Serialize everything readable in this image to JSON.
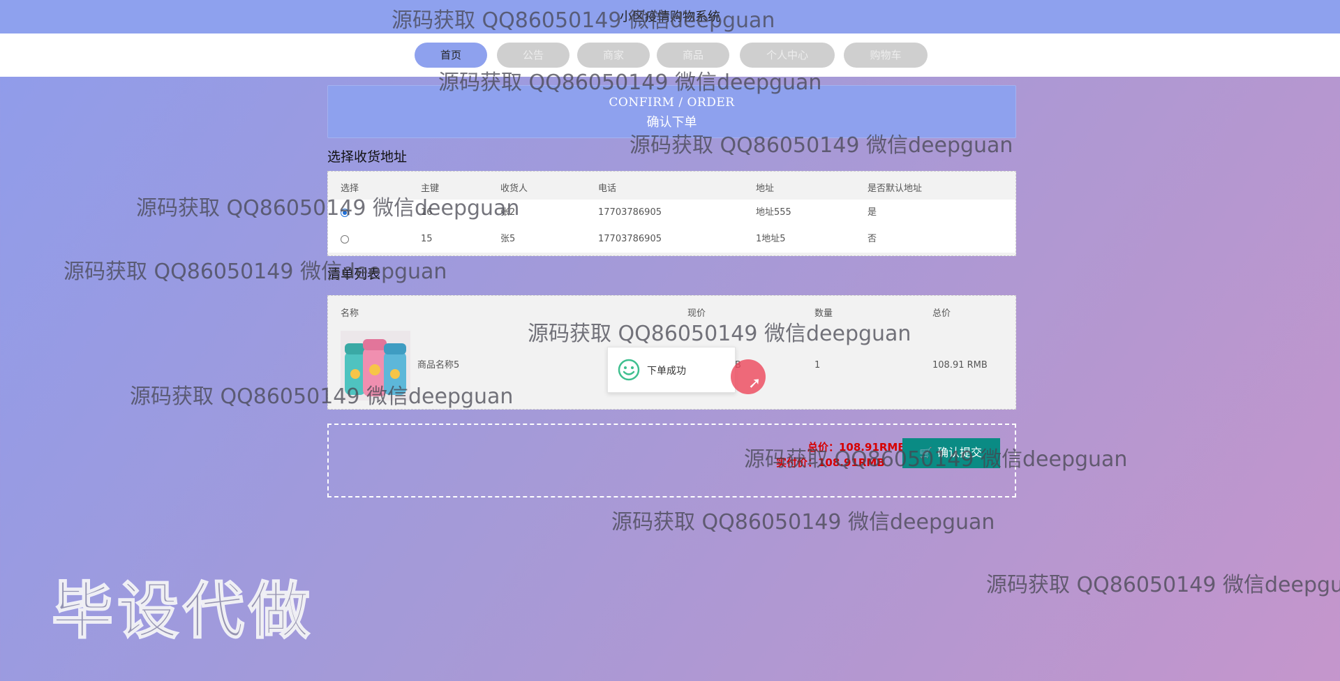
{
  "app": {
    "title": "小区疫情购物系统"
  },
  "nav": {
    "items": [
      {
        "label": "首页"
      },
      {
        "label": "公告"
      },
      {
        "label": "商家"
      },
      {
        "label": "商品"
      },
      {
        "label": "个人中心"
      },
      {
        "label": "购物车"
      }
    ]
  },
  "banner": {
    "en": "CONFIRM / ORDER",
    "cn": "确认下单"
  },
  "address": {
    "title": "选择收货地址",
    "headers": [
      "选择",
      "主键",
      "收货人",
      "电话",
      "地址",
      "是否默认地址"
    ],
    "rows": [
      {
        "id": "16",
        "name": "张2",
        "phone": "17703786905",
        "address": "地址555",
        "default": "是",
        "selected": true
      },
      {
        "id": "15",
        "name": "张5",
        "phone": "17703786905",
        "address": "1地址5",
        "default": "否",
        "selected": false
      }
    ]
  },
  "orderList": {
    "title": "清单列表",
    "headers": [
      "名称",
      "现价",
      "数量",
      "总价"
    ],
    "items": [
      {
        "name": "商品名称5",
        "price": "B",
        "qty": "1",
        "total": "108.91 RMB"
      }
    ]
  },
  "toast": {
    "message": "下单成功"
  },
  "summary": {
    "total": "总价：108.91RMB",
    "paid": "实付价：108.91RMB",
    "submit_label": "确认提交"
  },
  "watermarks": {
    "text": "源码获取 QQ86050149 微信deepguan",
    "big": "毕设代做"
  },
  "colors": {
    "accent": "#8ea1ee",
    "submit": "#0a8b84",
    "price": "#d60000"
  }
}
